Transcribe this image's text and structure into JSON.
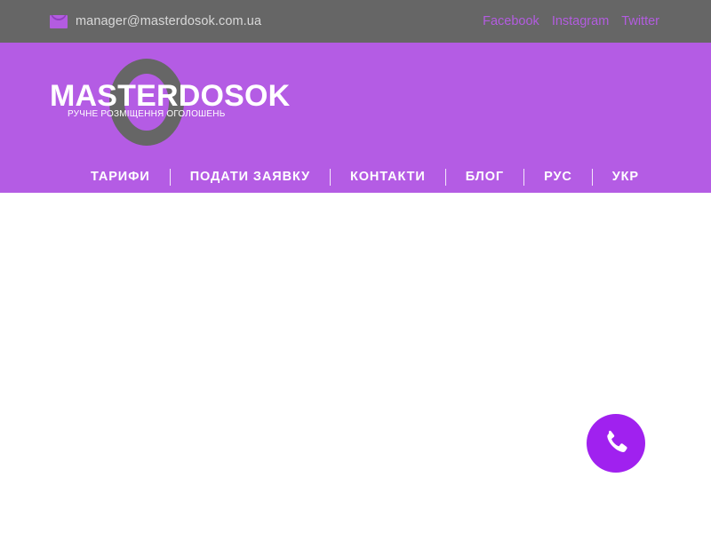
{
  "topbar": {
    "email": "manager@masterdosok.com.ua",
    "email_icon": "envelope-icon",
    "social": [
      {
        "label": "Facebook",
        "icon": "facebook-link"
      },
      {
        "label": "Instagram",
        "icon": "instagram-link"
      },
      {
        "label": "Twitter",
        "icon": "twitter-link"
      }
    ]
  },
  "header": {
    "brand_title": "MASTERDOSOK",
    "brand_tagline": "РУЧНЕ РОЗМІЩЕННЯ ОГОЛОШЕНЬ",
    "logo_icon": "ring-logo-icon",
    "background_color": "#b45ce4",
    "nav": [
      {
        "label": "ТАРИФИ",
        "name": "nav-item-tarifi",
        "active": false
      },
      {
        "label": "ПОДАТИ ЗАЯВКУ",
        "name": "nav-item-podati-zayavku",
        "active": false
      },
      {
        "label": "КОНТАКТИ",
        "name": "nav-item-kontakti",
        "active": false
      },
      {
        "label": "БЛОГ",
        "name": "nav-item-blog",
        "active": false
      },
      {
        "label": "РУС",
        "name": "nav-item-rus",
        "active": false
      },
      {
        "label": "УКР",
        "name": "nav-item-ukr",
        "active": true
      }
    ]
  },
  "main": {
    "content": ""
  },
  "callback": {
    "icon": "phone-icon",
    "color": "#a021ef"
  },
  "colors": {
    "topbar_background": "#666666",
    "header_purple": "#b45ce4",
    "accent_purple": "#b35ce0",
    "callback_purple": "#a021ef",
    "logo_ring_gray": "#666666",
    "topbar_text": "#d9d9d9"
  }
}
